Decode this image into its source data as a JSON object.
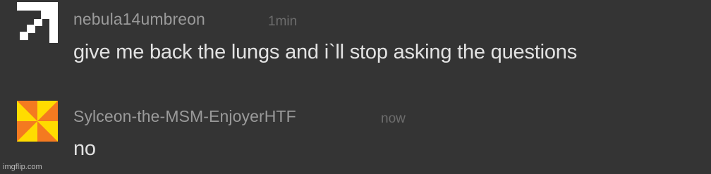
{
  "comments": [
    {
      "username": "nebula14umbreon",
      "timestamp": "1min",
      "message": "give me back the lungs and i`ll stop asking the questions",
      "avatar_icon": "pixel-arrow-icon",
      "avatar_colors": {
        "foreground": "#ffffff",
        "background": "#343434"
      }
    },
    {
      "username": "Sylceon-the-MSM-EnjoyerHTF",
      "timestamp": "now",
      "message": "no",
      "avatar_icon": "pinwheel-icon",
      "avatar_colors": {
        "primary": "#f47a20",
        "secondary": "#ffdc00"
      }
    }
  ],
  "watermark": "imgflip.com",
  "colors": {
    "background": "#343434",
    "username": "#9a9a9a",
    "timestamp": "#6d6d6d",
    "message": "#e2e2e2",
    "watermark": "#b8b8b8"
  }
}
